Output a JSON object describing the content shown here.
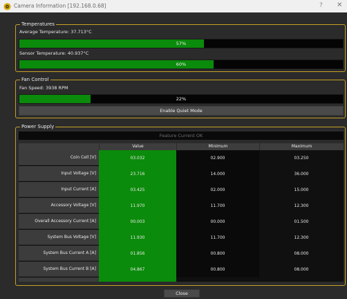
{
  "window": {
    "title": "Camera Information [192.168.0.68]",
    "help": "?",
    "close": "✕"
  },
  "temperatures": {
    "group_title": "Temperatures",
    "average_label": "Average Temperature: 37.713°C",
    "average_percent": 57,
    "average_text": "57%",
    "sensor_label": "Sensor Temperature: 40.937°C",
    "sensor_percent": 60,
    "sensor_text": "60%"
  },
  "fan_control": {
    "group_title": "Fan Control",
    "speed_label": "Fan Speed: 3938 RPM",
    "speed_percent": 22,
    "speed_text": "22%",
    "quiet_button": "Enable Quiet Mode"
  },
  "power_supply": {
    "group_title": "Power Supply",
    "status": "Feature Current OK",
    "columns": [
      "Value",
      "Minimum",
      "Maximum"
    ],
    "rows": [
      {
        "label": "Coin Cell [V]",
        "value": "03.032",
        "min": "02.900",
        "max": "03.250"
      },
      {
        "label": "Input Voltage [V]",
        "value": "23.716",
        "min": "14.000",
        "max": "36.000"
      },
      {
        "label": "Input Current [A]",
        "value": "03.425",
        "min": "02.000",
        "max": "15.000"
      },
      {
        "label": "Accessory Voltage [V]",
        "value": "11.970",
        "min": "11.700",
        "max": "12.300"
      },
      {
        "label": "Overall Accessory Current [A]",
        "value": "00.003",
        "min": "00.000",
        "max": "01.500"
      },
      {
        "label": "System Bus Voltage [V]",
        "value": "11.930",
        "min": "11.700",
        "max": "12.300"
      },
      {
        "label": "System Bus Current A [A]",
        "value": "01.856",
        "min": "00.800",
        "max": "08.000"
      },
      {
        "label": "System Bus Current B [A]",
        "value": "04.867",
        "min": "00.800",
        "max": "08.000"
      }
    ]
  },
  "footer": {
    "close_button": "Close"
  },
  "colors": {
    "accent_border": "#c9a227",
    "progress_fill": "#0b8b0b",
    "background": "#2b2b2b"
  }
}
